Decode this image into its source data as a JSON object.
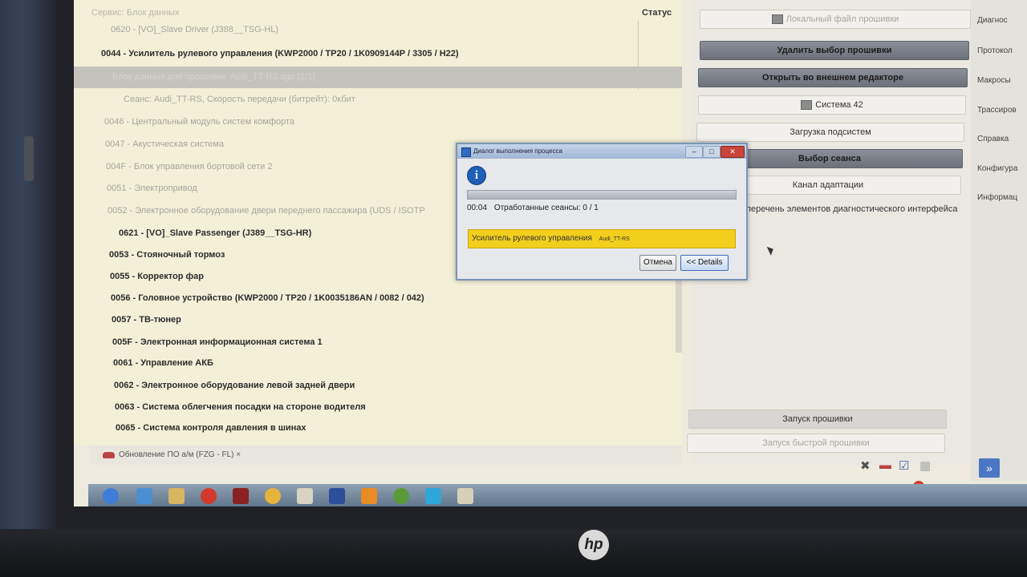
{
  "ecu_table": {
    "header_title": "Сервис: Блок данных",
    "header_status": "Статус",
    "rows": [
      {
        "text": "0620 - [VO]_Slave Driver (J388__TSG-HL)",
        "style": "dim"
      },
      {
        "text": "0044 - Усилитель рулевого управления  (KWP2000 / TP20 / 1K0909144P / 3305 / H22)",
        "style": "normal"
      },
      {
        "text": "Блок данных для прошивки: Audi_TT-RS.sgo (1/1)",
        "style": "sel"
      },
      {
        "text": "Сеанс: Audi_TT-RS, Скорость передачи (битрейт): 0кбит",
        "style": "dim"
      },
      {
        "text": "0046 - Центральный модуль систем комфорта",
        "style": "dim"
      },
      {
        "text": "0047 - Акустическая система",
        "style": "dim"
      },
      {
        "text": "004F - Блок управления бортовой сети 2",
        "style": "dim"
      },
      {
        "text": "0051 - Электропривод",
        "style": "dim"
      },
      {
        "text": "0052 - Электронное оборудование двери переднего пассажира  (UDS / ISOTP",
        "style": "dim"
      },
      {
        "text": "0621 - [VO]_Slave Passenger (J389__TSG-HR)",
        "style": "normal"
      },
      {
        "text": "0053 - Стояночный тормоз",
        "style": "normal"
      },
      {
        "text": "0055 - Корректор фар",
        "style": "normal"
      },
      {
        "text": "0056 - Головное устройство  (KWP2000 / TP20 / 1K0035186AN / 0082 / 042)",
        "style": "normal"
      },
      {
        "text": "0057 - ТВ-тюнер",
        "style": "normal"
      },
      {
        "text": "005F - Электронная информационная система 1",
        "style": "normal"
      },
      {
        "text": "0061 - Управление АКБ",
        "style": "normal"
      },
      {
        "text": "0062 - Электронное оборудование левой задней двери",
        "style": "normal"
      },
      {
        "text": "0063 - Система облегчения посадки на стороне водителя",
        "style": "normal"
      },
      {
        "text": "0065 - Система контроля давления в шинах",
        "style": "normal"
      }
    ]
  },
  "right_panel": {
    "local_file": "Локальный файл прошивки",
    "delete_selection": "Удалить выбор прошивки",
    "open_external": "Открыть во внешнем редакторе",
    "system42": "Система 42",
    "load_subsystems": "Загрузка подсистем",
    "select_session": "Выбор сеанса",
    "adaptation_channel": "Канал адаптации",
    "interface_list": "перечень элементов диагностического интерфейса",
    "start_flash": "Запуск прошивки",
    "start_quick_flash": "Запуск быстрой прошивки"
  },
  "side_menu": [
    "Диагнос",
    "Протокол",
    "Макросы",
    "Трассиров",
    "Справка",
    "Конфигура",
    "Информац"
  ],
  "tab": {
    "label": "Обновление ПО а/м (FZG - FL)",
    "close": "×"
  },
  "dialog": {
    "title": "Диалог выполнения процесса",
    "time": "00:04",
    "status": "Отработанные сеансы: 0 / 1",
    "progress": 0.0,
    "task_name": "Усилитель рулевого управления",
    "task_file": "Audi_TT-RS",
    "cancel": "Отмена",
    "details": "<< Details",
    "info_glyph": "i"
  },
  "colors": {
    "highlight": "#f3cf1d",
    "accent": "#4b76c4"
  },
  "brand": "hp"
}
